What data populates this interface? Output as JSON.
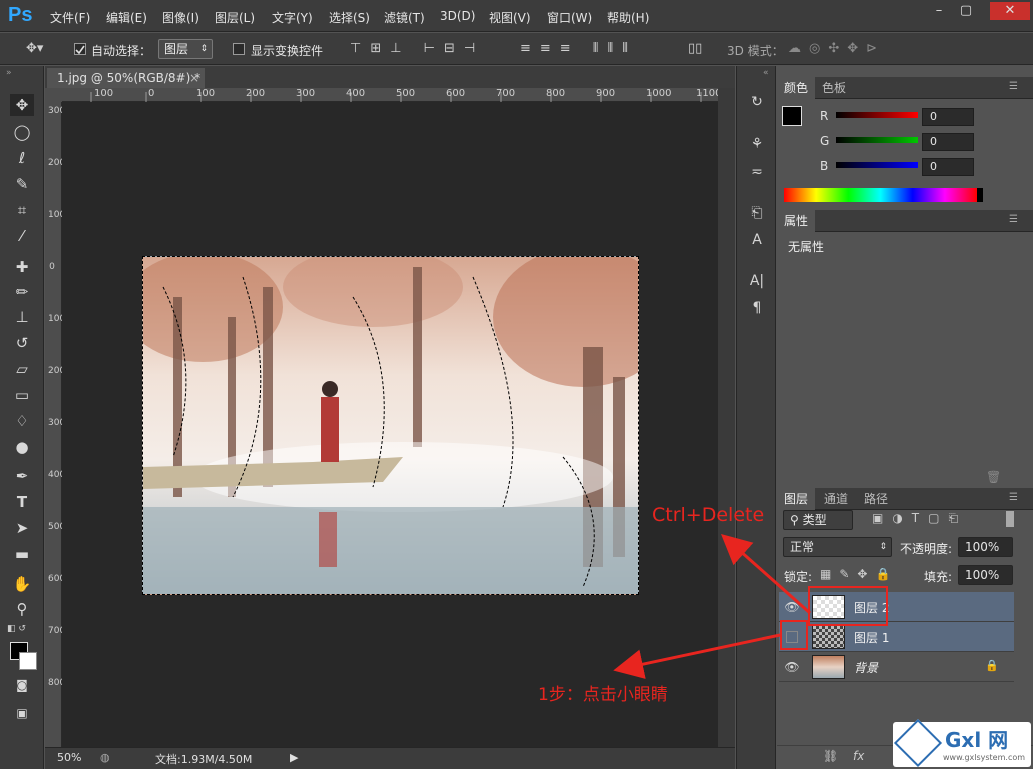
{
  "app": {
    "logo": "Ps"
  },
  "menu": [
    "文件(F)",
    "编辑(E)",
    "图像(I)",
    "图层(L)",
    "文字(Y)",
    "选择(S)",
    "滤镜(T)",
    "3D(D)",
    "视图(V)",
    "窗口(W)",
    "帮助(H)"
  ],
  "window_controls": {
    "minimize": "–",
    "maximize": "▢",
    "close": "✕"
  },
  "options": {
    "auto_select_label": "自动选择：",
    "auto_select_checked": true,
    "auto_select_target": "图层",
    "show_transform_label": "显示变换控件",
    "show_transform_checked": false,
    "mode_3d_label": "3D 模式："
  },
  "document": {
    "tab_title": "1.jpg @ 50%(RGB/8#) *",
    "close_glyph": "×",
    "ruler_top_labels": [
      "100",
      "0",
      "100",
      "200",
      "300",
      "400",
      "500",
      "600",
      "700",
      "800",
      "900",
      "1000",
      "1100"
    ],
    "ruler_left_labels": [
      "300",
      "200",
      "100",
      "0",
      "100",
      "200",
      "300",
      "400",
      "500",
      "600",
      "700",
      "800"
    ],
    "zoom": "50%",
    "doc_size": "文档:1.93M/4.50M"
  },
  "color_panel": {
    "tabs": [
      "颜色",
      "色板"
    ],
    "channels": [
      {
        "label": "R",
        "value": "0",
        "color": "#ff0000"
      },
      {
        "label": "G",
        "value": "0",
        "color": "#00c800"
      },
      {
        "label": "B",
        "value": "0",
        "color": "#0000ff"
      }
    ]
  },
  "properties_panel": {
    "tab": "属性",
    "empty_text": "无属性"
  },
  "layers_panel": {
    "tabs": [
      "图层",
      "通道",
      "路径"
    ],
    "filter_kind": "类型",
    "blend_mode": "正常",
    "opacity_label": "不透明度:",
    "opacity_value": "100%",
    "lock_label": "锁定:",
    "fill_label": "填充:",
    "fill_value": "100%",
    "layers": [
      {
        "name": "图层 2",
        "visible": true,
        "selected": true
      },
      {
        "name": "图层 1",
        "visible": false,
        "selected": true
      },
      {
        "name": "背景",
        "visible": true,
        "selected": false,
        "locked": true
      }
    ],
    "footer_icons": [
      "link-icon",
      "fx-icon"
    ]
  },
  "annotations": {
    "step1": "1步：点击小眼睛",
    "shortcut": "Ctrl+Delete"
  },
  "watermark": {
    "text": "Gxl 网",
    "url": "www.gxlsystem.com"
  },
  "colors": {
    "accent_red": "#e8251f",
    "ps_blue": "#31a8ff",
    "selection_blue": "#5a6a80"
  }
}
